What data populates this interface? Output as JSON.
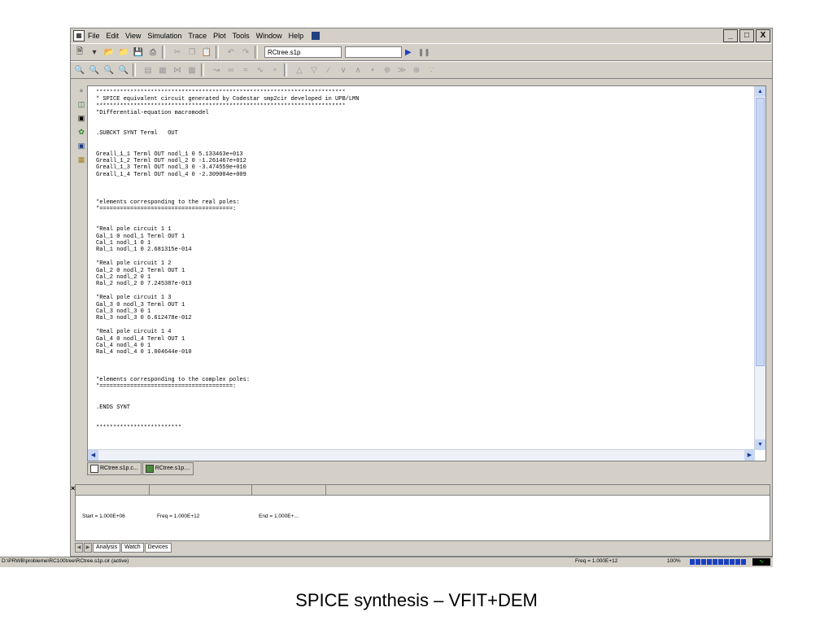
{
  "menu": [
    "File",
    "Edit",
    "View",
    "Simulation",
    "Trace",
    "Plot",
    "Tools",
    "Window",
    "Help"
  ],
  "window_controls": [
    "_",
    "□",
    "X"
  ],
  "toolbar": {
    "combo1": "RCtree.s1p",
    "combo2": ""
  },
  "code_lines": [
    "*************************************************************************",
    "* SPICE equivalent circuit generated by Codestar smp2cir developed in UPB/LMN",
    "*************************************************************************",
    "*Differential-equation macromodel",
    "",
    "",
    ".SUBCKT SYNT Terml   OUT",
    "",
    "",
    "Greall_1_1 Terml OUT nodl_1 0 5.133463e+013",
    "Greall_1_2 Terml OUT nodl_2 0 -1.261467e+012",
    "Greall_1_3 Terml OUT nodl_3 0 -3.474559e+010",
    "Greall_1_4 Terml OUT nodl_4 0 -2.309004e+009",
    "",
    "",
    "",
    "*elements corresponding to the real poles:",
    "*=======================================:",
    "",
    "",
    "*Real pole circuit 1 1",
    "Gal_1 0 nodl_1 Terml OUT 1",
    "Cal_1 nodl_1 0 1",
    "Ral_1 nodl_1 0 2.681315e-014",
    "",
    "*Real pole circuit 1 2",
    "Gal_2 0 nodl_2 Terml OUT 1",
    "Cal_2 nodl_2 0 1",
    "Ral_2 nodl_2 0 7.245387e-013",
    "",
    "*Real pole circuit 1 3",
    "Gal_3 0 nodl_3 Terml OUT 1",
    "Cal_3 nodl_3 0 1",
    "Ral_3 nodl_3 0 6.612478e-012",
    "",
    "*Real pole circuit 1 4",
    "Gal_4 0 nodl_4 Terml OUT 1",
    "Cal_4 nodl_4 0 1",
    "Ral_4 nodl_4 0 1.004644e-010",
    "",
    "",
    "",
    "*elements corresponding to the complex poles:",
    "*=======================================:",
    "",
    "",
    ".ENDS SYNT",
    "",
    "",
    "*************************"
  ],
  "doc_tabs": [
    "RCtree.s1p.c...",
    "RCtree.s1p...."
  ],
  "output": {
    "start": "Start = 1.000E+06",
    "freq": "Freq = 1.000E+12",
    "end": "End = 1.000E+..."
  },
  "bottom_tabs": [
    "Analysis",
    "Watch",
    "Devices"
  ],
  "status": {
    "path": "D:\\PRWB\\probleme\\RC100tree\\RCtree.s1p.cir (active)",
    "freq": "Freq = 1.000E+12",
    "zoom": "100%"
  },
  "caption": "SPICE synthesis – VFIT+DEM"
}
